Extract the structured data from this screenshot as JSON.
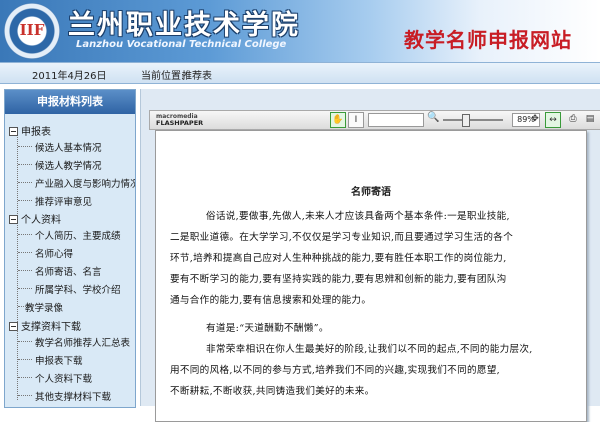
{
  "header": {
    "logo_mark": "IIF",
    "school_name_cn": "兰州职业技术学院",
    "school_name_en": "Lanzhou Vocational Technical College",
    "site_title": "教学名师申报网站"
  },
  "infobar": {
    "date": "2011年4月26日",
    "location_label": "当前位置:",
    "location_value": "推荐表"
  },
  "sidebar": {
    "title": "申报材料列表",
    "sections": [
      {
        "label": "申报表",
        "items": [
          "候选人基本情况",
          "候选人教学情况",
          "产业融入度与影响力情况",
          "推荐评审意见"
        ]
      },
      {
        "label": "个人资料",
        "items": [
          "个人简历、主要成绩",
          "名师心得",
          "名师寄语、名言",
          "所属学科、学校介绍"
        ]
      },
      {
        "label": "教学录像",
        "items": []
      },
      {
        "label": "支撑资料下载",
        "items": [
          "教学名师推荐人汇总表",
          "申报表下载",
          "个人资料下载",
          "其他支撑材料下载"
        ]
      }
    ]
  },
  "viewer": {
    "logo_line1": "macromedia",
    "logo_line2": "FLASHPAPER",
    "zoom": "89%",
    "icons": [
      "hand-icon",
      "select-icon",
      "search-icon",
      "fit-page-icon",
      "fit-width-icon",
      "print-icon",
      "menu-icon"
    ]
  },
  "document": {
    "title": "名师寄语",
    "lines": [
      "俗话说,要做事,先做人,未来人才应该具备两个基本条件:一是职业技能,",
      "二是职业道德。在大学学习,不仅仅是学习专业知识,而且要通过学习生活的各个",
      "环节,培养和提高自己应对人生种种挑战的能力,要有胜任本职工作的岗位能力,",
      "要有不断学习的能力,要有坚持实践的能力,要有思辨和创新的能力,要有团队沟",
      "通与合作的能力,要有信息搜索和处理的能力。",
      "有道是:“天道酬勤不酬懒”。",
      "非常荣幸相识在你人生最美好的阶段,让我们以不同的起点,不同的能力层次,",
      "用不同的风格,以不同的参与方式,培养我们不同的兴趣,实现我们不同的愿望,",
      "不断耕耘,不断收获,共同铸造我们美好的未来。"
    ]
  },
  "colors": {
    "site_title": "#c81d25",
    "sidebar_bg": "#d9e9f6",
    "sidebar_head": "#2f63a4"
  }
}
